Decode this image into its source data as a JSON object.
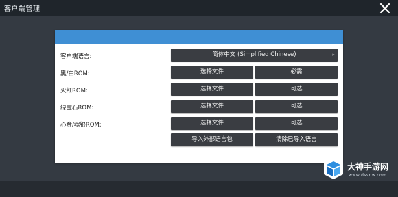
{
  "window": {
    "title": "客户端管理",
    "close_icon": "close-icon"
  },
  "dialog": {
    "header_color": "#3f8fd4",
    "rows": [
      {
        "label": "客户端语言:",
        "control": "简体中文 (Simplified Chinese)"
      },
      {
        "label": "黑/白ROM:",
        "left": "选择文件",
        "right": "必需"
      },
      {
        "label": "火红ROM:",
        "left": "选择文件",
        "right": "可选"
      },
      {
        "label": "绿宝石ROM:",
        "left": "选择文件",
        "right": "可选"
      },
      {
        "label": "心金/魂银ROM:",
        "left": "选择文件",
        "right": "可选"
      }
    ],
    "actions": {
      "import_label": "导入外部语言包",
      "clear_label": "清除已导入语言"
    }
  },
  "watermark": {
    "name": "大神手游网",
    "url": "www.dssnw.com"
  }
}
